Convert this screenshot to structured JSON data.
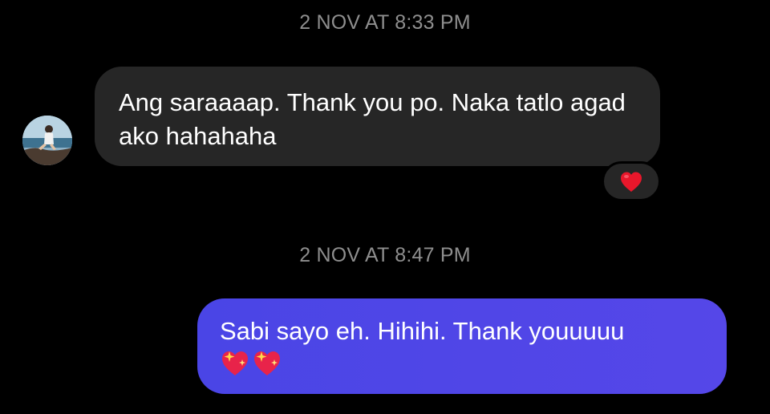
{
  "thread": {
    "messages": [
      {
        "timestamp": "2 NOV AT 8:33 PM",
        "direction": "incoming",
        "text": "Ang saraaaap. Thank you po. Naka tatlo agad ako hahahaha",
        "reaction_icon": "red-heart-icon"
      },
      {
        "timestamp": "2 NOV AT 8:47 PM",
        "direction": "outgoing",
        "text": "Sabi sayo eh. Hihihi. Thank youuuuu",
        "emojis": [
          "sparkling-heart-icon",
          "sparkling-heart-icon"
        ]
      }
    ]
  },
  "colors": {
    "background": "#000000",
    "incoming_bubble": "#262626",
    "outgoing_bubble": "#4f46e5",
    "timestamp_text": "#8e8e8e",
    "heart": "#e8172b"
  }
}
